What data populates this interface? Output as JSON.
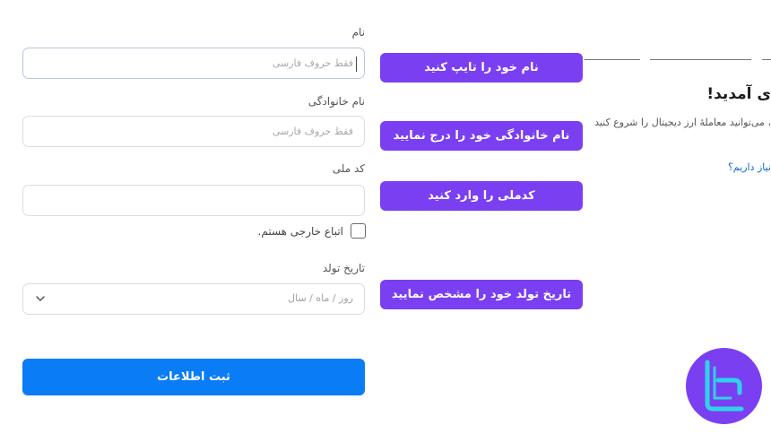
{
  "form": {
    "first_name_label": "نام",
    "first_name_placeholder": "فقط حروف فارسی",
    "last_name_label": "نام خانوادگی",
    "last_name_placeholder": "فقط حروف فارسی",
    "national_id_label": "کد ملی",
    "national_id_placeholder": "",
    "foreign_checkbox_label": "اتباع خارجی هستم.",
    "birth_date_label": "تاریخ تولد",
    "birth_date_placeholder": "روز / ماه / سال",
    "submit_label": "ثبت اطلاعات"
  },
  "callouts": {
    "first_name": "نام خود را تایپ کنید",
    "last_name": "نام خانوادگی خود را درج نمایید",
    "national_id": "کدملی را وارد کنید",
    "birth_date": "تاریخ تولد خود را مشخص نمایید"
  },
  "welcome_panel": {
    "heading": "ی آمدید!",
    "intro": "، می‌توانید معاملهٔ ارز دیجیتال را شروع کنید",
    "help_link": "نیاز داریم؟"
  },
  "colors": {
    "accent": "#7b3ff2",
    "primary_button": "#0a7cf5",
    "link": "#0a6ad8"
  },
  "icons": {
    "select_toggle": "chevron-down-icon",
    "logo": "tradingfinder-logo"
  }
}
